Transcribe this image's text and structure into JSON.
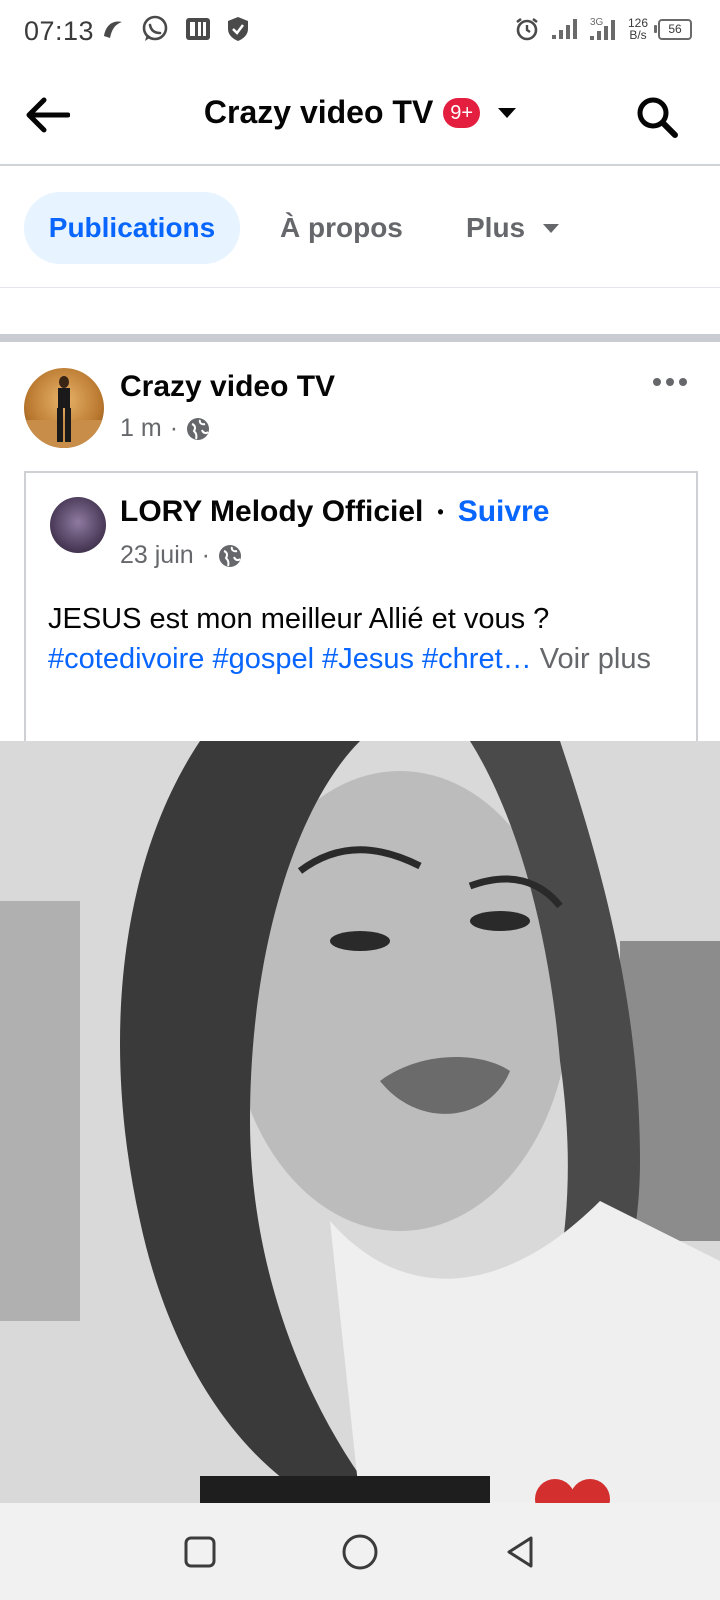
{
  "status_bar": {
    "time": "07:13",
    "network_speed_value": "126",
    "network_speed_unit": "B/s",
    "battery": "56",
    "icons_left": [
      "notification-app-icon",
      "whatsapp-icon",
      "parking-app-icon",
      "shield-icon"
    ],
    "icons_right": [
      "alarm-icon",
      "signal-icon",
      "signal-3g-icon"
    ]
  },
  "header": {
    "title": "Crazy video TV",
    "badge": "9+",
    "back_icon": "arrow-left-icon",
    "search_icon": "search-icon"
  },
  "tabs": [
    {
      "label": "Publications",
      "active": true
    },
    {
      "label": "À propos",
      "active": false
    },
    {
      "label": "Plus",
      "active": false
    }
  ],
  "post": {
    "author": "Crazy video TV",
    "time": "1 m",
    "separator": "·",
    "visibility_icon": "globe-icon",
    "shared": {
      "author": "LORY Melody Officiel",
      "dot": "•",
      "follow_label": "Suivre",
      "date": "23 juin",
      "separator": "·",
      "text": "JESUS est mon meilleur Allié et vous ?",
      "hashtags": [
        "#cotedivoire",
        "#gospel",
        "#Jesus",
        "#chret…"
      ],
      "see_more": "Voir plus"
    }
  },
  "colors": {
    "accent": "#0866ff",
    "badge": "#e41e3f",
    "tab_active_bg": "#e7f3ff",
    "muted_text": "#65676b"
  },
  "nav_bar": {
    "icons": [
      "recent-apps-square-icon",
      "home-circle-icon",
      "back-triangle-icon"
    ]
  }
}
